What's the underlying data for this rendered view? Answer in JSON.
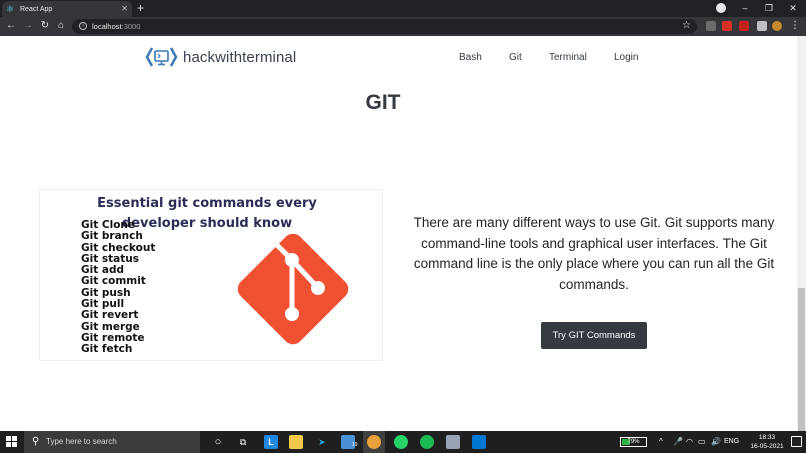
{
  "browser": {
    "tab_title": "React App",
    "new_tab": "+",
    "url_host": "localhost",
    "url_port": ":3000",
    "window_controls": [
      "–",
      "❐",
      "✕"
    ]
  },
  "navbar": {
    "brand": "hackwithterminal",
    "links": [
      "Bash",
      "Git",
      "Terminal",
      "Login"
    ]
  },
  "main": {
    "heading": "GIT",
    "image": {
      "title": "Essential git commands every developer should know",
      "commands": [
        "Git Clone",
        "Git branch",
        "Git checkout",
        "Git status",
        "Git add",
        "Git commit",
        "Git push",
        "Git pull",
        "Git revert",
        "Git merge",
        "Git remote",
        "Git fetch"
      ]
    },
    "description": "There are many different ways to use Git. Git supports many command-line tools and graphical user interfaces. The Git command line is the only place where you can run all the Git commands.",
    "cta": "Try GIT Commands"
  },
  "taskbar": {
    "search_placeholder": "Type here to search",
    "battery": "79%",
    "language": "ENG",
    "time": "18:33",
    "date": "16-05-2021",
    "mail_badge": "19"
  },
  "colors": {
    "git_logo": "#f05133",
    "brand_logo": "#3d7bb5",
    "cta_bg": "#343a40"
  }
}
